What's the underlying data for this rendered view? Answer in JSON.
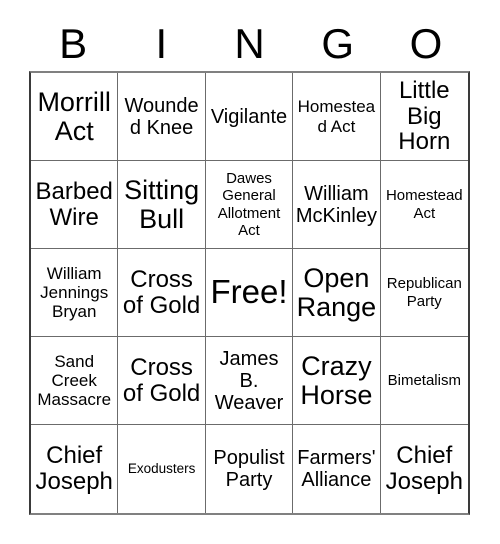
{
  "card": {
    "title": "BINGO",
    "header_letters": [
      "B",
      "I",
      "N",
      "G",
      "O"
    ],
    "columns": 5,
    "rows": 5,
    "free_space_label": "Free!",
    "free_space_position": "center",
    "colors": {
      "text": "#000000",
      "background": "#ffffff",
      "grid_line": "#6b6b6b",
      "outer_border": "#3a3a3a"
    },
    "cells": [
      {
        "text": "Morrill Act",
        "size": "xl",
        "row": 1,
        "col": 1
      },
      {
        "text": "Wounded Knee",
        "size": "md",
        "row": 1,
        "col": 2
      },
      {
        "text": "Vigilante",
        "size": "md",
        "row": 1,
        "col": 3
      },
      {
        "text": "Homestead Act",
        "size": "sm",
        "row": 1,
        "col": 4
      },
      {
        "text": "Little Big Horn",
        "size": "lg",
        "row": 1,
        "col": 5
      },
      {
        "text": "Barbed Wire",
        "size": "lg",
        "row": 2,
        "col": 1
      },
      {
        "text": "Sitting Bull",
        "size": "xl",
        "row": 2,
        "col": 2
      },
      {
        "text": "Dawes General Allotment Act",
        "size": "xs",
        "row": 2,
        "col": 3
      },
      {
        "text": "William McKinley",
        "size": "md",
        "row": 2,
        "col": 4
      },
      {
        "text": "Homestead Act",
        "size": "xs",
        "row": 2,
        "col": 5
      },
      {
        "text": "William Jennings Bryan",
        "size": "sm",
        "row": 3,
        "col": 1
      },
      {
        "text": "Cross of Gold",
        "size": "lg",
        "row": 3,
        "col": 2
      },
      {
        "text": "Free!",
        "size": "xxl",
        "row": 3,
        "col": 3
      },
      {
        "text": "Open Range",
        "size": "xl",
        "row": 3,
        "col": 4
      },
      {
        "text": "Republican Party",
        "size": "xs",
        "row": 3,
        "col": 5
      },
      {
        "text": "Sand Creek Massacre",
        "size": "sm",
        "row": 4,
        "col": 1
      },
      {
        "text": "Cross of Gold",
        "size": "lg",
        "row": 4,
        "col": 2
      },
      {
        "text": "James B. Weaver",
        "size": "md",
        "row": 4,
        "col": 3
      },
      {
        "text": "Crazy Horse",
        "size": "xl",
        "row": 4,
        "col": 4
      },
      {
        "text": "Bimetalism",
        "size": "xs",
        "row": 4,
        "col": 5
      },
      {
        "text": "Chief Joseph",
        "size": "lg",
        "row": 5,
        "col": 1
      },
      {
        "text": "Exodusters",
        "size": "xxs",
        "row": 5,
        "col": 2
      },
      {
        "text": "Populist Party",
        "size": "md",
        "row": 5,
        "col": 3
      },
      {
        "text": "Farmers' Alliance",
        "size": "md",
        "row": 5,
        "col": 4
      },
      {
        "text": "Chief Joseph",
        "size": "lg",
        "row": 5,
        "col": 5
      }
    ]
  }
}
